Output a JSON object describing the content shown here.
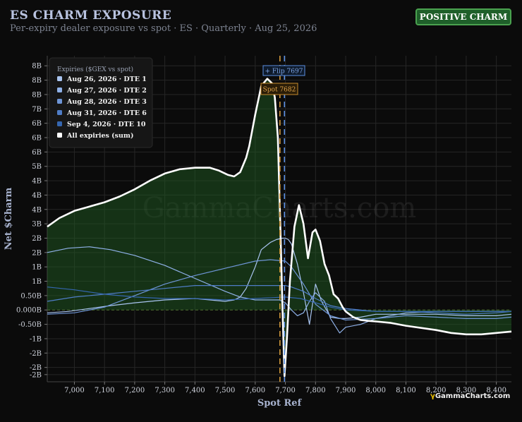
{
  "header": {
    "title": "ES CHARM EXPOSURE",
    "subtitle": "Per-expiry dealer exposure vs spot · ES · Quarterly · Aug 25, 2026",
    "badge": "POSITIVE CHARM"
  },
  "brand": {
    "glyph": "γ",
    "text": "GammaCharts.com"
  },
  "watermark": "GammaCharts.com",
  "chart_data": {
    "type": "line",
    "xlabel": "Spot Ref",
    "ylabel": "Net $Charm",
    "xlim": [
      6910,
      8450
    ],
    "ylim": [
      -2.5,
      8.85
    ],
    "x_ticks": [
      7000,
      7100,
      7200,
      7300,
      7400,
      7500,
      7600,
      7700,
      7800,
      7900,
      8000,
      8100,
      8200,
      8300,
      8400
    ],
    "x_tick_labels": [
      "7,000",
      "7,100",
      "7,200",
      "7,300",
      "7,400",
      "7,500",
      "7,600",
      "7,700",
      "7,800",
      "7,900",
      "8,000",
      "8,100",
      "8,200",
      "8,300",
      "8,400"
    ],
    "y_ticks": [
      -2.25,
      -2.0,
      -1.5,
      -1.0,
      -0.5,
      0,
      0.5,
      1.0,
      1.5,
      2.0,
      2.5,
      3.0,
      3.5,
      4.0,
      4.5,
      5.0,
      5.5,
      6.0,
      6.5,
      7.0,
      7.5,
      8.0,
      8.5
    ],
    "y_tick_labels": [
      "-2B",
      "-2B",
      "-2B",
      "-1B",
      "-0.50B",
      "0.000B",
      "0.50B",
      "1B",
      "1B",
      "2B",
      "2B",
      "3B",
      "4B",
      "4B",
      "4B",
      "5B",
      "6B",
      "6B",
      "6B",
      "7B",
      "8B",
      "8B",
      "8B"
    ],
    "grid": true,
    "legend": {
      "title": "Expiries ($GEX vs spot)",
      "position": "top-left"
    },
    "annotations": {
      "flip": {
        "x": 7697,
        "label": "+ Flip 7697"
      },
      "spot": {
        "x": 7682,
        "label": "Spot 7682"
      }
    },
    "series": [
      {
        "name": "Aug 26, 2026 · DTE 1",
        "color": "#a9c4f0",
        "width": 1.2,
        "x": [
          6910,
          6980,
          7050,
          7120,
          7200,
          7300,
          7400,
          7450,
          7500,
          7530,
          7550,
          7570,
          7600,
          7620,
          7650,
          7670,
          7690,
          7700,
          7710,
          7720,
          7740,
          7760,
          7780,
          7800,
          7820,
          7850,
          7880,
          7900,
          7950,
          8000,
          8100,
          8200,
          8300,
          8400,
          8450
        ],
        "y": [
          -0.1,
          -0.05,
          0.05,
          0.15,
          0.25,
          0.35,
          0.4,
          0.35,
          0.3,
          0.35,
          0.45,
          0.75,
          1.5,
          2.1,
          2.35,
          2.45,
          2.5,
          2.5,
          2.45,
          2.3,
          1.6,
          0.6,
          -0.5,
          0.9,
          0.3,
          -0.25,
          -0.3,
          -0.3,
          -0.25,
          -0.15,
          -0.15,
          -0.15,
          -0.2,
          -0.2,
          -0.15
        ]
      },
      {
        "name": "Aug 27, 2026 · DTE 2",
        "color": "#8fb1e8",
        "width": 1.2,
        "x": [
          6910,
          6980,
          7050,
          7120,
          7200,
          7300,
          7400,
          7500,
          7550,
          7600,
          7650,
          7680,
          7700,
          7720,
          7740,
          7760,
          7780,
          7800,
          7830,
          7850,
          7880,
          7900,
          7950,
          8000,
          8100,
          8200,
          8300,
          8400,
          8450
        ],
        "y": [
          2.0,
          2.15,
          2.2,
          2.1,
          1.9,
          1.55,
          1.1,
          0.65,
          0.45,
          0.35,
          0.35,
          0.35,
          0.25,
          0.0,
          -0.2,
          -0.1,
          0.3,
          0.6,
          0.3,
          -0.3,
          -0.8,
          -0.6,
          -0.5,
          -0.3,
          -0.1,
          -0.05,
          -0.05,
          -0.05,
          -0.05
        ]
      },
      {
        "name": "Aug 28, 2026 · DTE 3",
        "color": "#6e95d6",
        "width": 1.2,
        "x": [
          6910,
          7000,
          7100,
          7200,
          7300,
          7400,
          7500,
          7600,
          7650,
          7700,
          7720,
          7760,
          7800,
          7850,
          7900,
          8000,
          8100,
          8200,
          8300,
          8400,
          8450
        ],
        "y": [
          -0.15,
          -0.1,
          0.1,
          0.5,
          0.9,
          1.2,
          1.45,
          1.7,
          1.75,
          1.7,
          1.5,
          0.9,
          0.2,
          -0.2,
          -0.35,
          -0.3,
          -0.2,
          -0.25,
          -0.3,
          -0.3,
          -0.25
        ]
      },
      {
        "name": "Aug 31, 2026 · DTE 6",
        "color": "#4f7dc7",
        "width": 1.2,
        "x": [
          6910,
          7000,
          7100,
          7200,
          7300,
          7400,
          7500,
          7600,
          7650,
          7700,
          7720,
          7760,
          7800,
          7850,
          7900,
          8000,
          8100,
          8200,
          8300,
          8400,
          8450
        ],
        "y": [
          0.3,
          0.45,
          0.55,
          0.65,
          0.75,
          0.85,
          0.85,
          0.85,
          0.85,
          0.85,
          0.8,
          0.65,
          0.4,
          0.15,
          0.05,
          -0.05,
          -0.05,
          -0.1,
          -0.15,
          -0.1,
          -0.05
        ]
      },
      {
        "name": "Sep 4, 2026 · DTE 10",
        "color": "#3566b0",
        "width": 1.2,
        "x": [
          6910,
          7000,
          7100,
          7200,
          7300,
          7400,
          7500,
          7600,
          7700,
          7750,
          7800,
          7850,
          7900,
          8000,
          8100,
          8200,
          8300,
          8400,
          8450
        ],
        "y": [
          0.8,
          0.7,
          0.55,
          0.45,
          0.4,
          0.4,
          0.35,
          0.4,
          0.45,
          0.4,
          0.25,
          0.1,
          0.0,
          -0.05,
          -0.05,
          -0.05,
          -0.05,
          -0.05,
          -0.05
        ]
      },
      {
        "name": "All expiries (sum)",
        "color": "#ffffff",
        "width": 2.6,
        "fill": true,
        "x": [
          6910,
          6950,
          7000,
          7050,
          7100,
          7150,
          7200,
          7250,
          7300,
          7350,
          7400,
          7450,
          7480,
          7510,
          7530,
          7550,
          7570,
          7580,
          7600,
          7620,
          7640,
          7655,
          7665,
          7675,
          7683,
          7690,
          7697,
          7705,
          7715,
          7730,
          7745,
          7760,
          7775,
          7790,
          7800,
          7815,
          7830,
          7845,
          7860,
          7875,
          7890,
          7900,
          7925,
          7950,
          7975,
          8000,
          8050,
          8100,
          8200,
          8250,
          8300,
          8350,
          8400,
          8450
        ],
        "y": [
          2.9,
          3.2,
          3.45,
          3.6,
          3.75,
          3.95,
          4.2,
          4.5,
          4.75,
          4.9,
          4.95,
          4.95,
          4.85,
          4.7,
          4.65,
          4.8,
          5.3,
          5.7,
          6.8,
          7.8,
          8.05,
          7.9,
          7.4,
          6.0,
          3.0,
          0.2,
          -2.3,
          -1.0,
          1.0,
          2.9,
          3.65,
          3.0,
          1.8,
          2.7,
          2.8,
          2.4,
          1.6,
          1.2,
          0.55,
          0.4,
          0.1,
          -0.05,
          -0.25,
          -0.35,
          -0.38,
          -0.4,
          -0.45,
          -0.55,
          -0.7,
          -0.8,
          -0.85,
          -0.85,
          -0.8,
          -0.75
        ]
      }
    ]
  }
}
